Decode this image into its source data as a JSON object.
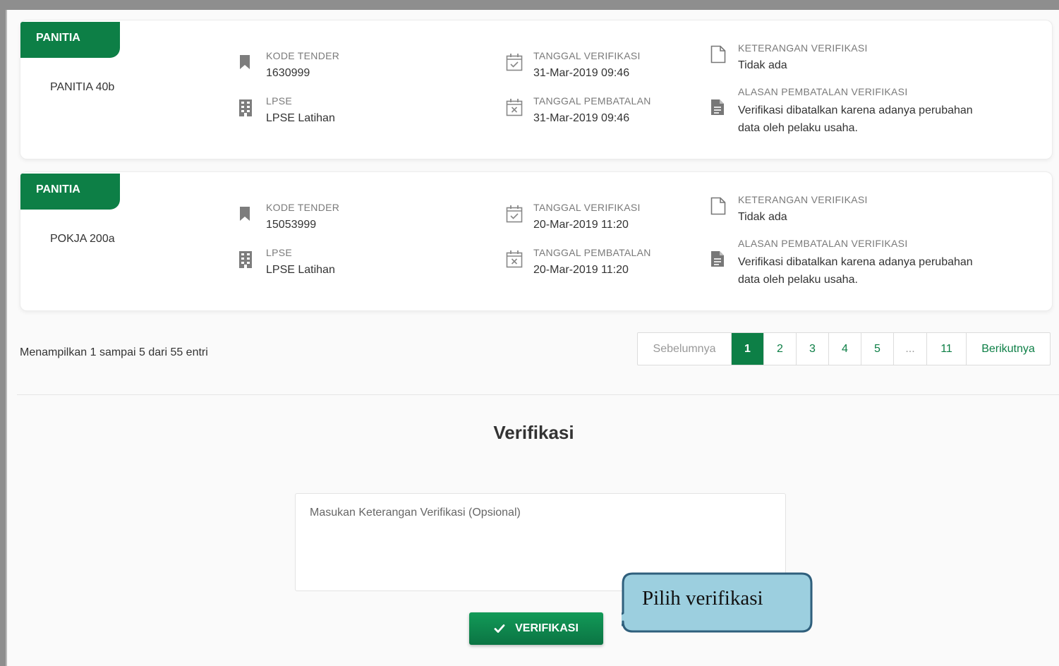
{
  "cards": [
    {
      "role": "PANITIA",
      "group": "PANITIA 40b",
      "kode_tender_label": "KODE TENDER",
      "kode_tender": "1630999",
      "lpse_label": "LPSE",
      "lpse": "LPSE Latihan",
      "tgl_verifikasi_label": "TANGGAL VERIFIKASI",
      "tgl_verifikasi": "31-Mar-2019 09:46",
      "tgl_pembatalan_label": "TANGGAL PEMBATALAN",
      "tgl_pembatalan": "31-Mar-2019 09:46",
      "keterangan_label": "KETERANGAN VERIFIKASI",
      "keterangan": "Tidak ada",
      "alasan_label": "ALASAN PEMBATALAN VERIFIKASI",
      "alasan": "Verifikasi dibatalkan karena adanya perubahan data oleh pelaku usaha."
    },
    {
      "role": "PANITIA",
      "group": "POKJA 200a",
      "kode_tender_label": "KODE TENDER",
      "kode_tender": "15053999",
      "lpse_label": "LPSE",
      "lpse": "LPSE Latihan",
      "tgl_verifikasi_label": "TANGGAL VERIFIKASI",
      "tgl_verifikasi": "20-Mar-2019 11:20",
      "tgl_pembatalan_label": "TANGGAL PEMBATALAN",
      "tgl_pembatalan": "20-Mar-2019 11:20",
      "keterangan_label": "KETERANGAN VERIFIKASI",
      "keterangan": "Tidak ada",
      "alasan_label": "ALASAN PEMBATALAN VERIFIKASI",
      "alasan": "Verifikasi dibatalkan karena adanya perubahan data oleh pelaku usaha."
    }
  ],
  "pagination": {
    "summary": "Menampilkan 1 sampai 5 dari 55 entri",
    "prev": "Sebelumnya",
    "pages": [
      "1",
      "2",
      "3",
      "4",
      "5",
      "...",
      "11"
    ],
    "active_page": "1",
    "next": "Berikutnya"
  },
  "verification": {
    "title": "Verifikasi",
    "notes_placeholder": "Masukan Keterangan Verifikasi (Opsional)",
    "button_label": "VERIFIKASI",
    "button_icon": "check-icon"
  },
  "annotation": {
    "callout_text": "Pilih verifikasi"
  },
  "colors": {
    "brand_green": "#0d7f46",
    "callout_fill": "#9ccfdf",
    "callout_border": "#2f5f7c"
  }
}
